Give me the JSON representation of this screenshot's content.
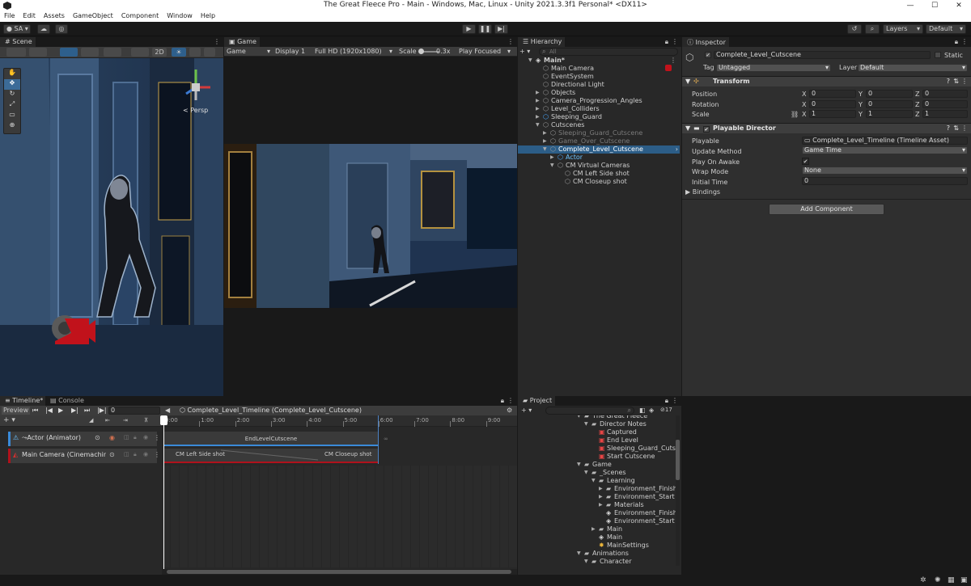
{
  "window": {
    "title": "The Great Fleece Pro - Main - Windows, Mac, Linux - Unity 2021.3.3f1 Personal* <DX11>",
    "minimize": "—",
    "maximize": "☐",
    "close": "✕"
  },
  "menu": [
    "File",
    "Edit",
    "Assets",
    "GameObject",
    "Component",
    "Window",
    "Help"
  ],
  "toolbar": {
    "account": "SA",
    "layers": "Layers",
    "layout": "Default"
  },
  "scene": {
    "tab": "Scene",
    "persp": "< Persp",
    "mode_2d": "2D"
  },
  "game": {
    "tab": "Game",
    "display_mode": "Game",
    "display": "Display 1",
    "resolution": "Full HD (1920x1080)",
    "scale_label": "Scale",
    "scale_value": "0.3x",
    "play_mode": "Play Focused"
  },
  "hierarchy": {
    "tab": "Hierarchy",
    "search_placeholder": "All",
    "rows": [
      {
        "label": "Main*",
        "indent": 0,
        "state": "normal",
        "arrow": "▼",
        "icon": "unity"
      },
      {
        "label": "Main Camera",
        "indent": 1,
        "state": "normal",
        "arrow": "",
        "icon": "cube"
      },
      {
        "label": "EventSystem",
        "indent": 1,
        "state": "normal",
        "arrow": "",
        "icon": "cube"
      },
      {
        "label": "Directional Light",
        "indent": 1,
        "state": "normal",
        "arrow": "",
        "icon": "cube"
      },
      {
        "label": "Objects",
        "indent": 1,
        "state": "normal",
        "arrow": "▶",
        "icon": "cube"
      },
      {
        "label": "Camera_Progression_Angles",
        "indent": 1,
        "state": "normal",
        "arrow": "▶",
        "icon": "cube"
      },
      {
        "label": "Level_Colliders",
        "indent": 1,
        "state": "normal",
        "arrow": "▶",
        "icon": "cube"
      },
      {
        "label": "Sleeping_Guard",
        "indent": 1,
        "state": "normal",
        "arrow": "▶",
        "icon": "blue"
      },
      {
        "label": "Cutscenes",
        "indent": 1,
        "state": "normal",
        "arrow": "▼",
        "icon": "cube"
      },
      {
        "label": "Sleeping_Guard_Cutscene",
        "indent": 2,
        "state": "dim",
        "arrow": "▶",
        "icon": "cube"
      },
      {
        "label": "Game_Over_Cutscene",
        "indent": 2,
        "state": "dim",
        "arrow": "▶",
        "icon": "cube"
      },
      {
        "label": "Complete_Level_Cutscene",
        "indent": 2,
        "state": "sel",
        "arrow": "▼",
        "icon": "cube"
      },
      {
        "label": "Actor",
        "indent": 3,
        "state": "blue",
        "arrow": "▶",
        "icon": "blue"
      },
      {
        "label": "CM Virtual Cameras",
        "indent": 3,
        "state": "normal",
        "arrow": "▼",
        "icon": "cube"
      },
      {
        "label": "CM Left Side shot",
        "indent": 4,
        "state": "normal",
        "arrow": "",
        "icon": "cube"
      },
      {
        "label": "CM Closeup shot",
        "indent": 4,
        "state": "normal",
        "arrow": "",
        "icon": "cube"
      }
    ]
  },
  "inspector": {
    "tab": "Inspector",
    "object_name": "Complete_Level_Cutscene",
    "static": "Static",
    "tag_label": "Tag",
    "tag_value": "Untagged",
    "layer_label": "Layer",
    "layer_value": "Default",
    "transform": {
      "title": "Transform",
      "rows": [
        {
          "label": "Position",
          "x": "0",
          "y": "0",
          "z": "0"
        },
        {
          "label": "Rotation",
          "x": "0",
          "y": "0",
          "z": "0"
        },
        {
          "label": "Scale",
          "x": "1",
          "y": "1",
          "z": "1"
        }
      ]
    },
    "director": {
      "title": "Playable Director",
      "playable_label": "Playable",
      "playable_value": "Complete_Level_Timeline (Timeline Asset)",
      "update_label": "Update Method",
      "update_value": "Game Time",
      "awake_label": "Play On Awake",
      "awake_value": "✔",
      "wrap_label": "Wrap Mode",
      "wrap_value": "None",
      "initial_label": "Initial Time",
      "initial_value": "0",
      "bindings_label": "Bindings"
    },
    "add_component": "Add Component"
  },
  "timeline": {
    "tab": "Timeline*",
    "console_tab": "Console",
    "preview": "Preview",
    "frame": "0",
    "asset": "Complete_Level_Timeline (Complete_Level_Cutscene)",
    "ticks": [
      "0:00",
      "1:00",
      "2:00",
      "3:00",
      "4:00",
      "5:00",
      "6:00",
      "7:00",
      "8:00",
      "9:00"
    ],
    "tracks": [
      {
        "name": "Actor (Animator)",
        "clips": [
          "EndLevelCutscene"
        ]
      },
      {
        "name": "Main Camera (Cinemachine",
        "clips": [
          "CM Left Side shot",
          "CM Closeup shot"
        ]
      }
    ]
  },
  "project": {
    "tab": "Project",
    "hidden_count": "17",
    "rows": [
      {
        "label": "The Great Fleece",
        "indent": 0,
        "arrow": "▼",
        "icon": "folder"
      },
      {
        "label": "Director Notes",
        "indent": 1,
        "arrow": "▼",
        "icon": "folder"
      },
      {
        "label": "Captured",
        "indent": 2,
        "arrow": "",
        "icon": "red"
      },
      {
        "label": "End Level",
        "indent": 2,
        "arrow": "",
        "icon": "red"
      },
      {
        "label": "Sleeping_Guard_Cutscene",
        "indent": 2,
        "arrow": "",
        "icon": "red"
      },
      {
        "label": "Start Cutscene",
        "indent": 2,
        "arrow": "",
        "icon": "red"
      },
      {
        "label": "Game",
        "indent": 0,
        "arrow": "▼",
        "icon": "folder"
      },
      {
        "label": "_Scenes",
        "indent": 1,
        "arrow": "▼",
        "icon": "folder"
      },
      {
        "label": "Learning",
        "indent": 2,
        "arrow": "▼",
        "icon": "folder"
      },
      {
        "label": "Environment_Finished",
        "indent": 3,
        "arrow": "▶",
        "icon": "folder"
      },
      {
        "label": "Environment_Start",
        "indent": 3,
        "arrow": "▶",
        "icon": "folder"
      },
      {
        "label": "Materials",
        "indent": 3,
        "arrow": "▶",
        "icon": "folder"
      },
      {
        "label": "Environment_Finished",
        "indent": 3,
        "arrow": "",
        "icon": "unity"
      },
      {
        "label": "Environment_Start",
        "indent": 3,
        "arrow": "",
        "icon": "unity"
      },
      {
        "label": "Main",
        "indent": 2,
        "arrow": "▶",
        "icon": "folder"
      },
      {
        "label": "Main",
        "indent": 2,
        "arrow": "",
        "icon": "unity"
      },
      {
        "label": "MainSettings",
        "indent": 2,
        "arrow": "",
        "icon": "yellow"
      },
      {
        "label": "Animations",
        "indent": 0,
        "arrow": "▼",
        "icon": "folder"
      },
      {
        "label": "Character",
        "indent": 1,
        "arrow": "▼",
        "icon": "folder"
      }
    ]
  },
  "colors": {
    "selection": "#2c5d87",
    "accent_blue": "#4c9be8",
    "track_red": "#b0121c",
    "playhead": "#ffffff"
  }
}
